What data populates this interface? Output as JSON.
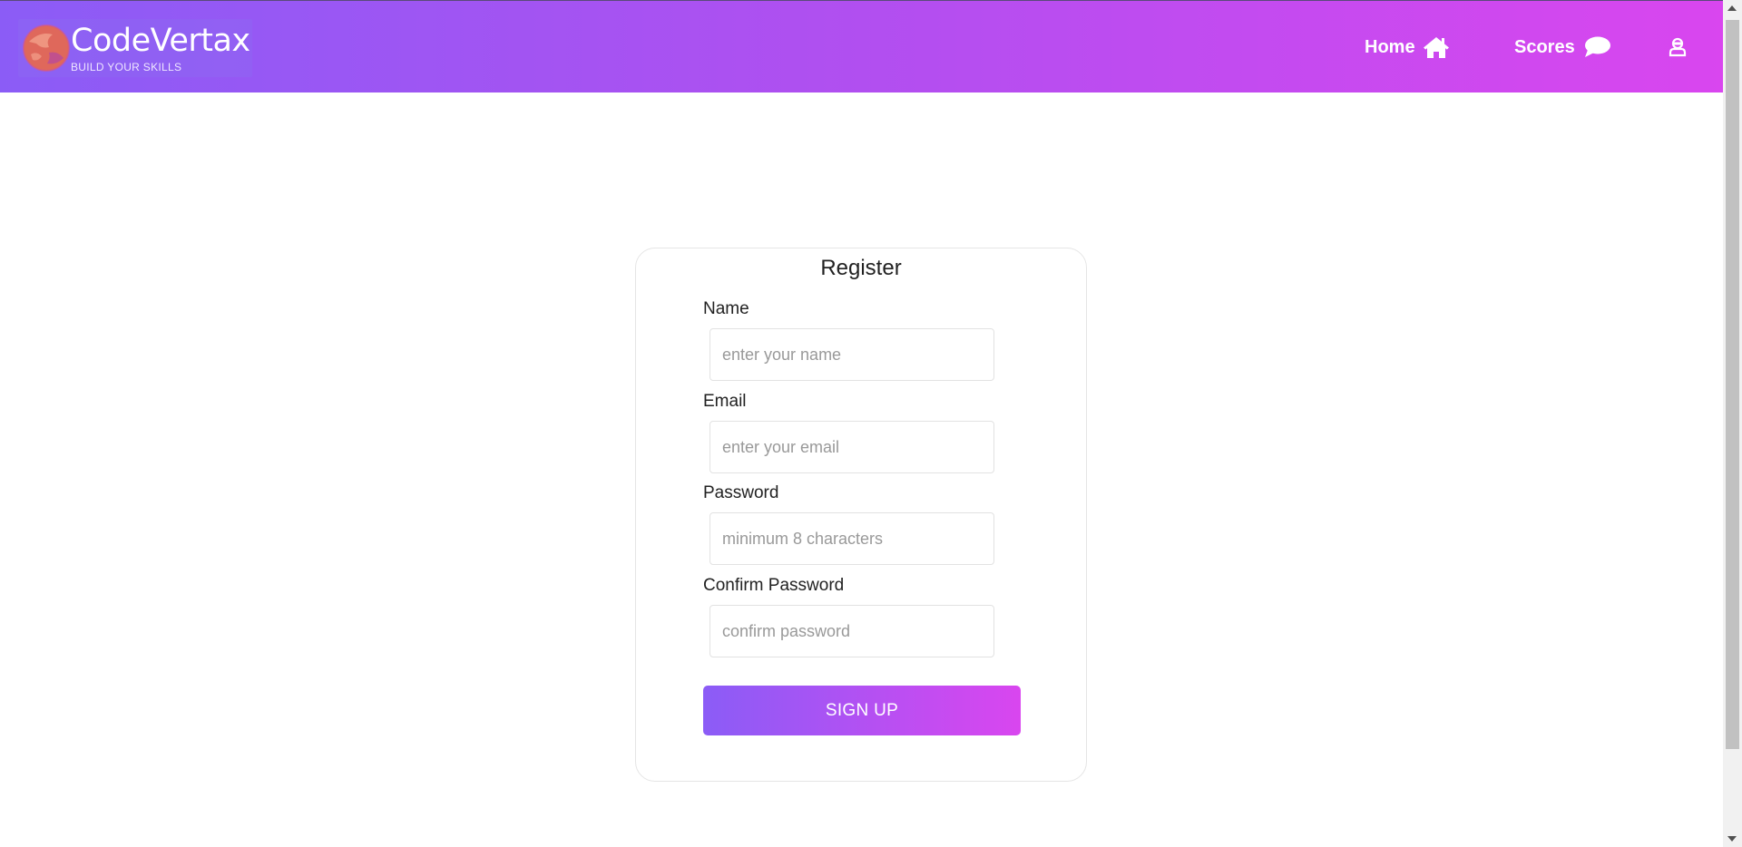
{
  "header": {
    "logo_title": "CodeVertax",
    "logo_tagline": "BUILD YOUR SKILLS",
    "nav": {
      "home_label": "Home",
      "home_icon": "home-icon",
      "scores_label": "Scores",
      "scores_icon": "chat-bubble-icon",
      "user_icon": "user-icon"
    }
  },
  "form": {
    "title": "Register",
    "fields": [
      {
        "label": "Name",
        "placeholder": "enter your name",
        "value": ""
      },
      {
        "label": "Email",
        "placeholder": "enter your email",
        "value": ""
      },
      {
        "label": "Password",
        "placeholder": "minimum 8 characters",
        "value": ""
      },
      {
        "label": "Confirm Password",
        "placeholder": "confirm password",
        "value": ""
      }
    ],
    "submit_label": "SIGN UP"
  },
  "colors": {
    "gradient_start": "#8b5cf6",
    "gradient_end": "#d946ef",
    "logo_mark": "#e8694a"
  }
}
